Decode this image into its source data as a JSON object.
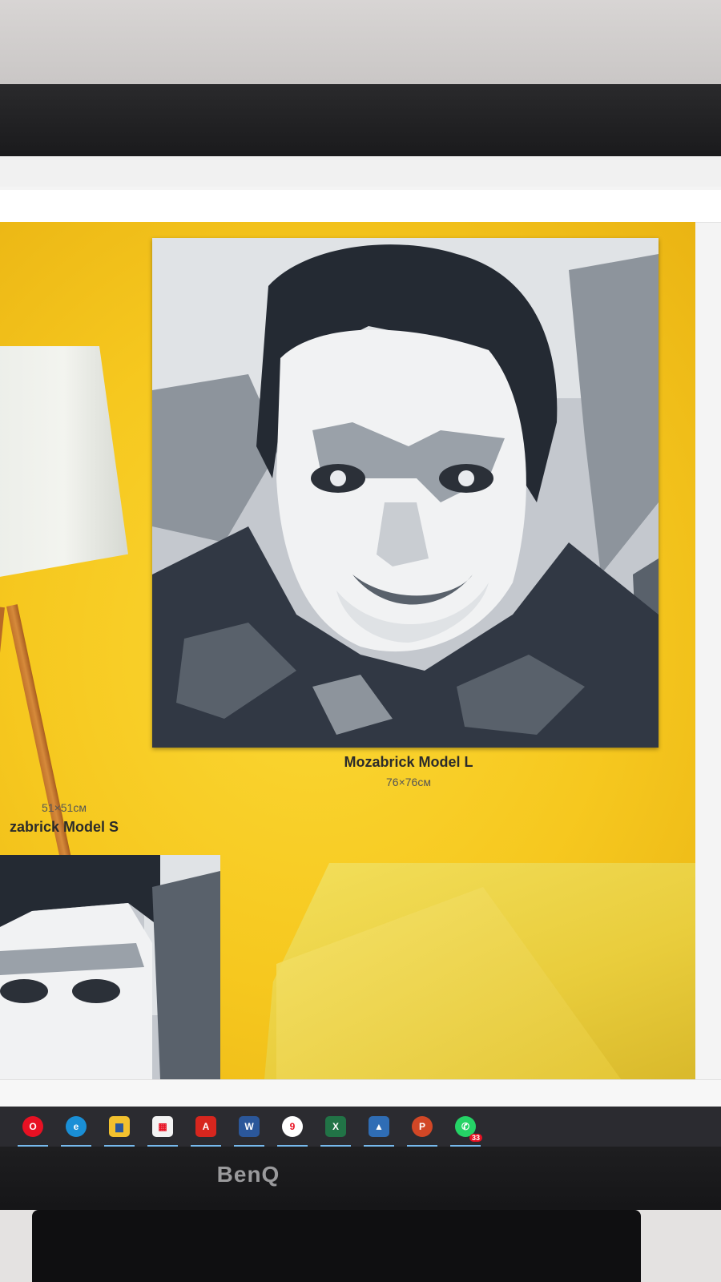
{
  "products": {
    "large": {
      "title": "Mozabrick Model L",
      "size": "76×76см"
    },
    "small": {
      "title": "zabrick Model S",
      "size": "51×51см"
    }
  },
  "monitor": {
    "brand": "BenQ"
  },
  "taskbar": {
    "apps": [
      {
        "name": "opera",
        "glyph": "O",
        "color": "#e81123"
      },
      {
        "name": "edge",
        "glyph": "e",
        "color": "#1a8fd6"
      },
      {
        "name": "file-explorer",
        "glyph": "▆",
        "color": "#f2c12e"
      },
      {
        "name": "microsoft-store",
        "glyph": "▦",
        "color": "#f3f3f3"
      },
      {
        "name": "acrobat",
        "glyph": "A",
        "color": "#d7261e"
      },
      {
        "name": "word",
        "glyph": "W",
        "color": "#2b579a"
      },
      {
        "name": "app-9",
        "glyph": "9",
        "color": "#e81123"
      },
      {
        "name": "excel",
        "glyph": "X",
        "color": "#217346"
      },
      {
        "name": "photos",
        "glyph": "▲",
        "color": "#2f6db5"
      },
      {
        "name": "powerpoint",
        "glyph": "P",
        "color": "#d24726"
      },
      {
        "name": "whatsapp",
        "glyph": "✆",
        "color": "#25d366",
        "badge": "33"
      }
    ]
  }
}
